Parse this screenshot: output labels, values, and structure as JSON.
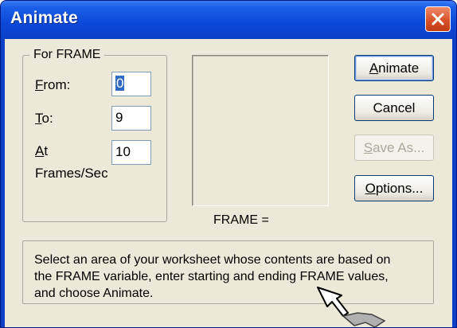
{
  "window": {
    "title": "Animate",
    "close_icon": "close-icon"
  },
  "group": {
    "title": "For FRAME"
  },
  "fields": {
    "from": {
      "label_key": "F",
      "label_rest": "rom:",
      "value": "0"
    },
    "to": {
      "label_key": "T",
      "label_rest": "o:",
      "value": "9"
    },
    "at": {
      "label_key": "A",
      "label_rest": "t",
      "value": "10",
      "suffix": "Frames/Sec"
    }
  },
  "preview": {
    "caption": "FRAME ="
  },
  "buttons": {
    "animate": {
      "key": "A",
      "rest": "nimate"
    },
    "cancel": {
      "label": "Cancel"
    },
    "save_as": {
      "key": "S",
      "rest": "ave As..."
    },
    "options": {
      "key": "O",
      "rest": "ptions..."
    }
  },
  "info": {
    "lines": [
      "Select an area of your worksheet whose contents are based on",
      "the FRAME variable, enter starting and ending FRAME values,",
      "and choose Animate."
    ]
  },
  "colors": {
    "titlebar": "#0a3fc8",
    "dialog_bg": "#ece9d8",
    "close_button": "#d8512a",
    "selection": "#316ac5"
  }
}
